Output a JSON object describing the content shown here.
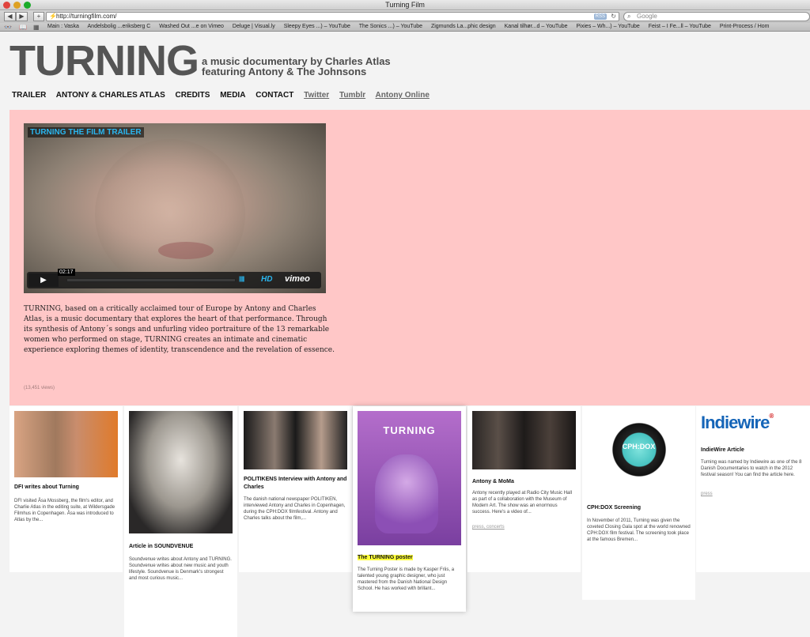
{
  "window": {
    "title": "Turning Film"
  },
  "browser": {
    "url": "http://turningfilm.com/",
    "rss": "RSS",
    "search_placeholder": "Google",
    "bookmarks": [
      "Main : Vaska",
      "Andelsbolig ...eriksberg C",
      "Washed Out ...e on Vimeo",
      "Deluge | Visual.ly",
      "Sleepy Eyes ...) – YouTube",
      "The Sonics ...) – YouTube",
      "Zigmunds La...phic design",
      "Kanal tilhør...d – YouTube",
      "Pixies – Wh...) – YouTube",
      "Feist – I Fe...ll – YouTube",
      "Print-Process / Hom"
    ]
  },
  "site": {
    "logo": "TURNING",
    "tagline_1": "a music documentary by Charles Atlas",
    "tagline_2": "featuring Antony & The Johnsons",
    "nav": [
      "TRAILER",
      "ANTONY & CHARLES ATLAS",
      "CREDITS",
      "MEDIA",
      "CONTACT"
    ],
    "nav_ext": [
      "Twitter",
      "Tumblr",
      "Antony Online"
    ]
  },
  "video": {
    "title": "TURNING THE FILM TRAILER",
    "timecode": "02:17",
    "hd": "HD",
    "brand": "vimeo"
  },
  "description": "TURNING, based on a critically acclaimed tour of Europe by Antony and Charles Atlas, is a music documentary that explores the heart of that performance. Through its synthesis of Antony´s songs and unfurling video portraiture of the 13 remarkable women who performed on stage, TURNING creates an intimate and cinematic experience exploring themes of identity, transcendence and the revelation of essence.",
  "views": "(13,451 views)",
  "cards": [
    {
      "title": "DFI writes about Turning",
      "text": "DFI visited Åsa Mossberg, the film's editor, and Charlie Atlas in the editing suite, at Wildersgade Filmhus in Copenhagen. Åsa was introduced to Atlas by the..."
    },
    {
      "title": "Article in SOUNDVENUE",
      "text": "Soundvenue writes about Antony and TURNING. Soundvenue writes about new music and youth lifestyle. Soundvenue is Denmark's strongest and most curious music..."
    },
    {
      "title": "POLITIKENS Interview with Antony and Charles",
      "text": "The danish national newspaper POLITIKEN, interviewed Antony and Charles in Copenhagen, during the CPH:DOX filmfestival. Antony and Charles talks about the film,..."
    },
    {
      "title": "The TURNING poster",
      "text": "The Turning Poster is made by Kasper Friis, a talented young graphic designer, who just mastered from the Danish National Design School. He has worked with brillant...",
      "poster_title": "TURNING"
    },
    {
      "title": "Antony & MoMa",
      "text": "Antony recently played at Radio City Music Hall as part of a collaboration with the Museum of Modern Art. The show was an enormous success. Here's a video of...",
      "tags": "press, concerts"
    },
    {
      "title": "CPH:DOX Screening",
      "text": "In November of 2011, Turning was given the coveted Closing Gala spot at the world renowned CPH:DOX film festival. The screening took place at the famous Bremen...",
      "logo_text": "CPH:DOX"
    },
    {
      "title": "IndieWire Article",
      "text": "Turning was named by Indiewire as one of the 8 Danish Documentaries to watch in the 2012 festival season! You can find the article here.",
      "tags": "press",
      "logo_text": "Indiewire"
    }
  ]
}
